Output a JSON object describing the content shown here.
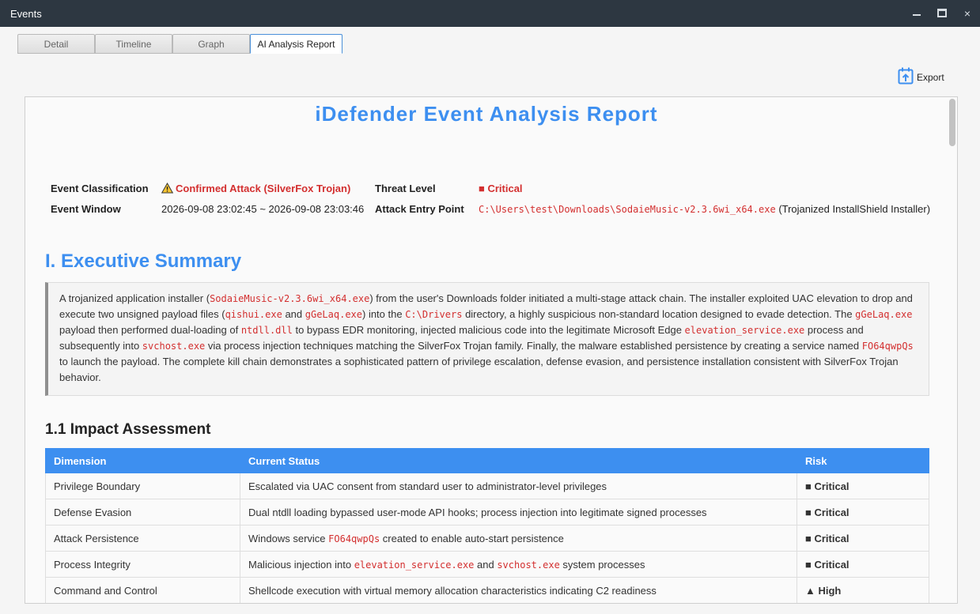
{
  "window": {
    "title": "Events",
    "minimize": "–",
    "maximize": "□",
    "close": "×"
  },
  "tabs": [
    "Detail",
    "Timeline",
    "Graph",
    "AI Analysis Report"
  ],
  "export_label": "Export",
  "report": {
    "title": "iDefender Event Analysis Report",
    "meta": {
      "classification_label": "Event Classification",
      "classification_value": "Confirmed Attack (SilverFox Trojan)",
      "threat_label": "Threat Level",
      "threat_value": "■ Critical",
      "window_label": "Event Window",
      "window_value": "2026-09-08 23:02:45 ~ 2026-09-08 23:03:46",
      "entry_label": "Attack Entry Point",
      "entry_path": "C:\\Users\\test\\Downloads\\SodaieMusic-v2.3.6wi_x64.exe",
      "entry_note": "(Trojanized InstallShield Installer)"
    },
    "summary_heading": "I. Executive Summary",
    "summary": {
      "t1": "A trojanized application installer (",
      "c1": "SodaieMusic-v2.3.6wi_x64.exe",
      "t2": ") from the user's Downloads folder initiated a multi-stage attack chain. The installer exploited UAC elevation to drop and execute two unsigned payload files (",
      "c2": "qishui.exe",
      "t3": " and ",
      "c3": "gGeLaq.exe",
      "t4": ") into the ",
      "c4": "C:\\Drivers",
      "t5": " directory, a highly suspicious non-standard location designed to evade detection. The ",
      "c5": "gGeLaq.exe",
      "t6": " payload then performed dual-loading of ",
      "c6": "ntdll.dll",
      "t7": " to bypass EDR monitoring, injected malicious code into the legitimate Microsoft Edge ",
      "c7": "elevation_service.exe",
      "t8": " process and subsequently into ",
      "c8": "svchost.exe",
      "t9": " via process injection techniques matching the SilverFox Trojan family. Finally, the malware established persistence by creating a service named ",
      "c9": "FO64qwpQs",
      "t10": " to launch the payload. The complete kill chain demonstrates a sophisticated pattern of privilege escalation, defense evasion, and persistence installation consistent with SilverFox Trojan behavior."
    },
    "impact_heading": "1.1 Impact Assessment",
    "impact_headers": {
      "dimension": "Dimension",
      "status": "Current Status",
      "risk": "Risk"
    },
    "impact_rows": [
      {
        "dimension": "Privilege Boundary",
        "s1": "Escalated via UAC consent from standard user to administrator-level privileges",
        "risk": "■ Critical"
      },
      {
        "dimension": "Defense Evasion",
        "s1": "Dual ntdll loading bypassed user-mode API hooks; process injection into legitimate signed processes",
        "risk": "■ Critical"
      },
      {
        "dimension": "Attack Persistence",
        "s1": "Windows service ",
        "c1": "FO64qwpQs",
        "s2": " created to enable auto-start persistence",
        "risk": "■ Critical"
      },
      {
        "dimension": "Process Integrity",
        "s1": "Malicious injection into ",
        "c1": "elevation_service.exe",
        "s2": " and ",
        "c2": "svchost.exe",
        "s3": " system processes",
        "risk": "■ Critical"
      },
      {
        "dimension": "Command and Control",
        "s1": "Shellcode execution with virtual memory allocation characteristics indicating C2 readiness",
        "risk": "▲ High"
      }
    ]
  }
}
